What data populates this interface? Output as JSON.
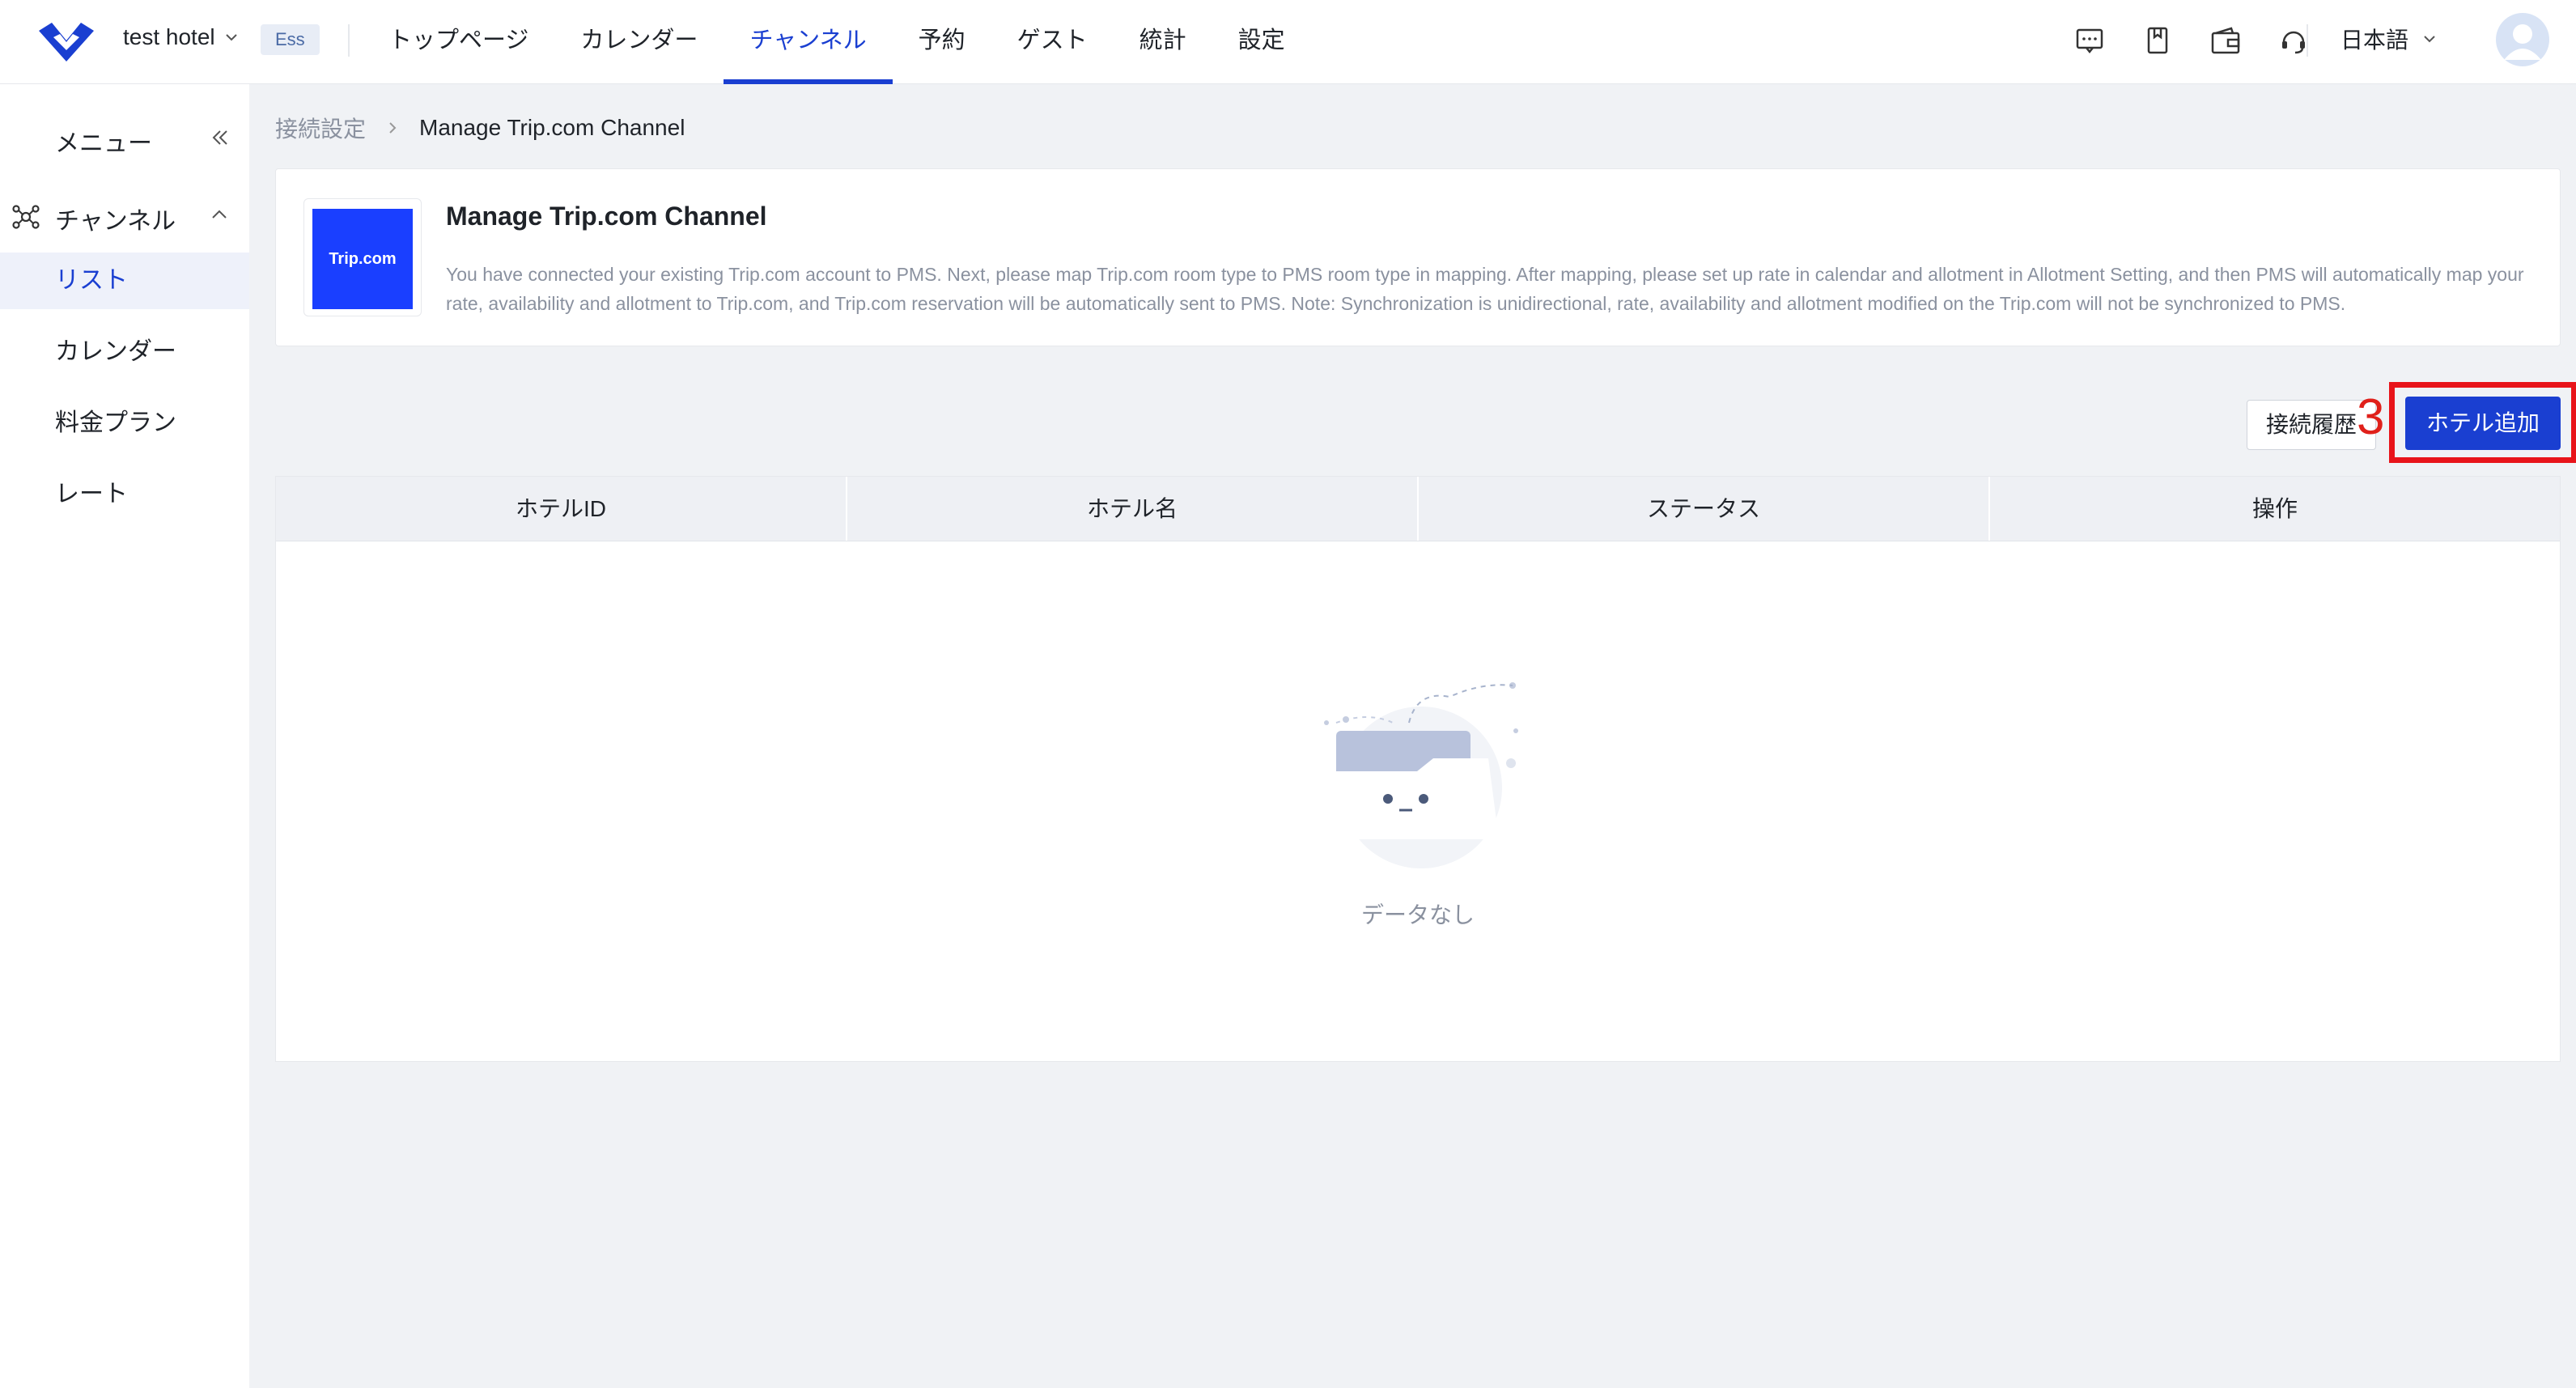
{
  "header": {
    "hotel_name": "test hotel",
    "plan_badge": "Ess",
    "nav": [
      {
        "label": "トップページ"
      },
      {
        "label": "カレンダー"
      },
      {
        "label": "チャンネル"
      },
      {
        "label": "予約"
      },
      {
        "label": "ゲスト"
      },
      {
        "label": "統計"
      },
      {
        "label": "設定"
      }
    ],
    "active_nav": "チャンネル",
    "icons": [
      "message-icon",
      "bookmark-icon",
      "wallet-icon",
      "support-icon"
    ],
    "language": "日本語"
  },
  "sidebar": {
    "menu_label": "メニュー",
    "group_label": "チャンネル",
    "items": [
      {
        "label": "リスト"
      },
      {
        "label": "カレンダー"
      },
      {
        "label": "料金プラン"
      },
      {
        "label": "レート"
      }
    ]
  },
  "breadcrumb": {
    "prev": "接続設定",
    "current": "Manage Trip.com Channel"
  },
  "card": {
    "logo_text": "Trip.com",
    "title": "Manage Trip.com Channel",
    "description": "You have connected your existing Trip.com account to PMS. Next, please map Trip.com room type to PMS room type in mapping. After mapping, please set up rate in calendar and allotment in Allotment Setting, and then PMS will automatically map your rate, availability and allotment to Trip.com, and Trip.com reservation will be automatically sent to PMS. Note: Synchronization is unidirectional, rate, availability and allotment modified on the Trip.com will not be synchronized to PMS."
  },
  "actions": {
    "history_label": "接続履歴",
    "step_number": "3",
    "add_hotel_label": "ホテル追加"
  },
  "table": {
    "columns": [
      "ホテルID",
      "ホテル名",
      "ステータス",
      "操作"
    ],
    "empty_text": "データなし"
  },
  "colors": {
    "accent": "#1a3fd1",
    "highlight": "#e8141a"
  }
}
